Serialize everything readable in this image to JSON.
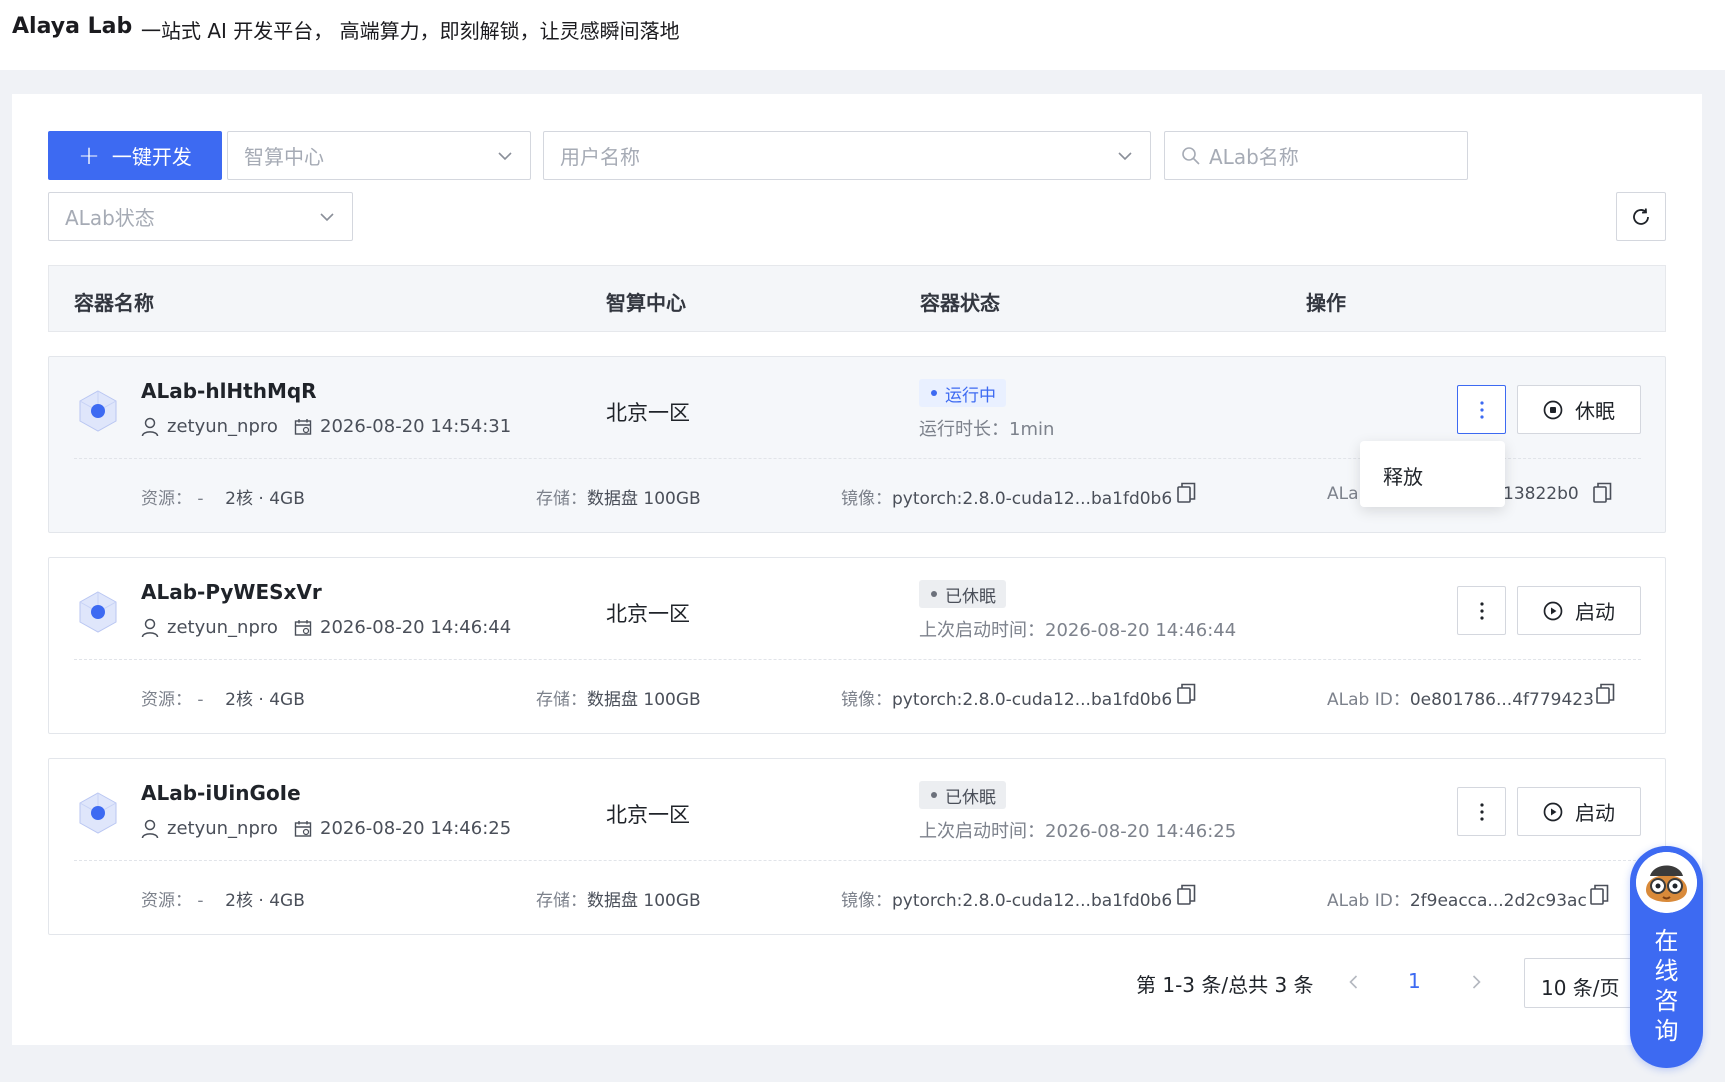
{
  "header": {
    "brand": "Alaya Lab",
    "tagline": "一站式 AI 开发平台， 高端算力，即刻解锁，让灵感瞬间落地"
  },
  "toolbar": {
    "create_label": "一键开发",
    "center_placeholder": "智算中心",
    "user_placeholder": "用户名称",
    "search_placeholder": "ALab名称",
    "status_placeholder": "ALab状态"
  },
  "table": {
    "headers": [
      "容器名称",
      "智算中心",
      "容器状态",
      "操作"
    ]
  },
  "labels": {
    "resource": "资源：",
    "storage": "存储：",
    "image": "镜像：",
    "alab_id": "ALab ID："
  },
  "rows": [
    {
      "name": "ALab-hlHthMqR",
      "user": "zetyun_npro",
      "created": "2026-08-20 14:54:31",
      "center": "北京一区",
      "status": "运行中",
      "status_sub_label": "运行时长：",
      "status_sub_value": "1min",
      "action": "休眠",
      "resource_dash": "-",
      "resource": "2核 · 4GB",
      "storage": "数据盘 100GB",
      "image": "pytorch:2.8.0-cuda12...ba1fd0b6",
      "alab_id_prefix": "ALal",
      "alab_id": "13822b0"
    },
    {
      "name": "ALab-PyWESxVr",
      "user": "zetyun_npro",
      "created": "2026-08-20 14:46:44",
      "center": "北京一区",
      "status": "已休眠",
      "status_sub_label": "上次启动时间：",
      "status_sub_value": "2026-08-20 14:46:44",
      "action": "启动",
      "resource_dash": "-",
      "resource": "2核 · 4GB",
      "storage": "数据盘 100GB",
      "image": "pytorch:2.8.0-cuda12...ba1fd0b6",
      "alab_id": "0e801786...4f779423"
    },
    {
      "name": "ALab-iUinGoIe",
      "user": "zetyun_npro",
      "created": "2026-08-20 14:46:25",
      "center": "北京一区",
      "status": "已休眠",
      "status_sub_label": "上次启动时间：",
      "status_sub_value": "2026-08-20 14:46:25",
      "action": "启动",
      "resource_dash": "-",
      "resource": "2核 · 4GB",
      "storage": "数据盘 100GB",
      "image": "pytorch:2.8.0-cuda12...ba1fd0b6",
      "alab_id": "2f9eacca...2d2c93ac"
    }
  ],
  "dropdown": {
    "release_label": "释放"
  },
  "pagination": {
    "summary": "第 1-3 条/总共 3 条",
    "current_page": "1",
    "page_size": "10 条/页"
  },
  "consult": {
    "label": "在线咨询"
  },
  "colors": {
    "accent": "#3d6af2",
    "running_bg": "#e9f0ff",
    "sleeping_bg": "#eceef1",
    "page_bg": "#f0f2f6"
  },
  "icons": {
    "create": "plus-icon",
    "dropdown": "chevron-down-icon",
    "search": "search-icon",
    "refresh": "refresh-icon",
    "container": "cube-icon",
    "user": "user-icon",
    "date": "calendar-icon",
    "more": "more-vertical-icon",
    "sleep": "stop-circle-icon",
    "start": "play-circle-icon",
    "copy": "copy-icon",
    "prev": "chevron-left-icon",
    "next": "chevron-right-icon"
  }
}
